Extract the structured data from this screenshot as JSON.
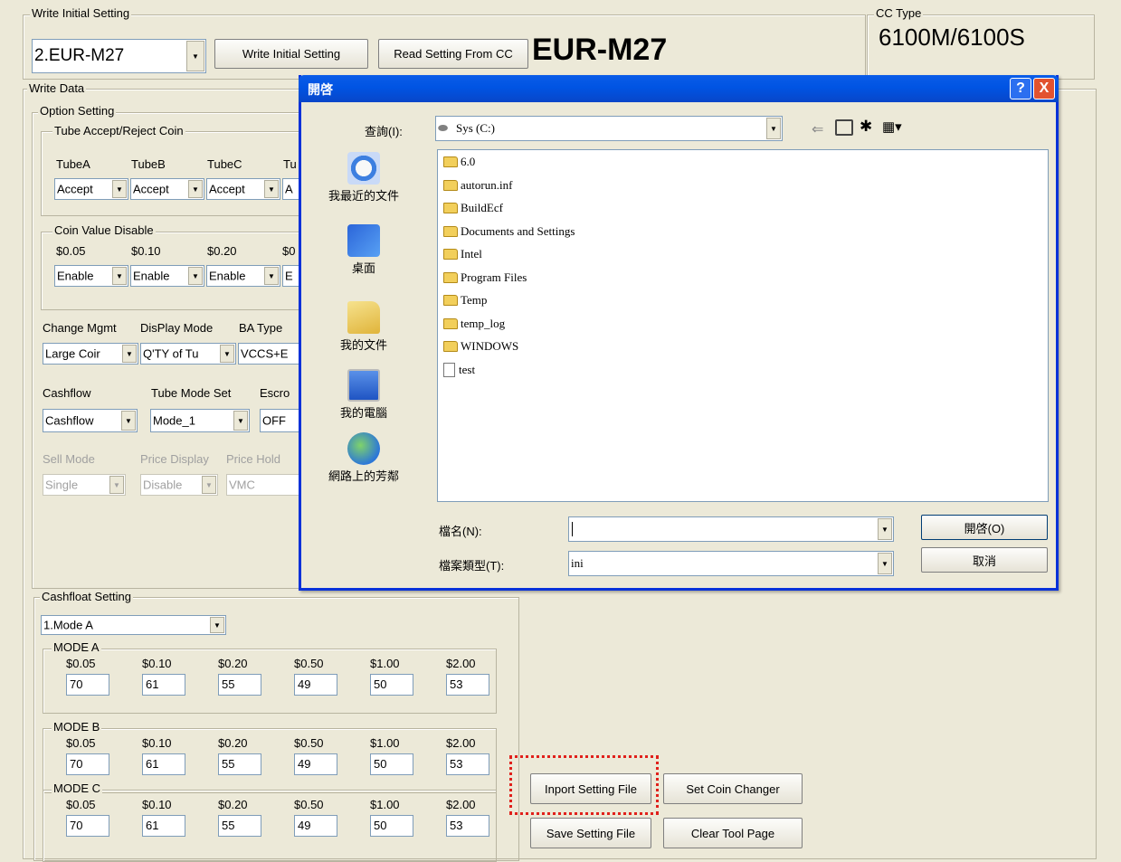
{
  "write_initial": {
    "legend": "Write Initial Setting",
    "combo_value": "2.EUR-M27",
    "write_button": "Write Initial Setting",
    "read_button": "Read Setting From CC",
    "big_label": "EUR-M27"
  },
  "cc_type": {
    "legend": "CC Type",
    "value": "6100M/6100S"
  },
  "write_data": {
    "legend": "Write Data",
    "option_legend": "Option Setting",
    "tube_legend": "Tube Accept/Reject Coin",
    "tube_headers": [
      "TubeA",
      "TubeB",
      "TubeC",
      "Tu"
    ],
    "tube_values": [
      "Accept",
      "Accept",
      "Accept",
      "A"
    ],
    "coin_legend": "Coin Value Disable",
    "coin_headers": [
      "$0.05",
      "$0.10",
      "$0.20",
      "$0"
    ],
    "coin_values": [
      "Enable",
      "Enable",
      "Enable",
      "E"
    ],
    "mgmt_headers": [
      "Change Mgmt",
      "DisPlay Mode",
      "BA Type"
    ],
    "mgmt_values": [
      "Large Coir",
      "Q'TY of Tu",
      "VCCS+E"
    ],
    "cash_headers": [
      "Cashflow",
      "Tube Mode Set",
      "Escro"
    ],
    "cash_values": [
      "Cashflow",
      "Mode_1",
      "OFF"
    ],
    "sell_headers": [
      "Sell Mode",
      "Price Display",
      "Price Hold"
    ],
    "sell_values": [
      "Single",
      "Disable",
      "VMC"
    ]
  },
  "cashfloat": {
    "legend": "Cashfloat Setting",
    "mode_select": "1.Mode A",
    "modes": [
      {
        "legend": "MODE A",
        "headers": [
          "$0.05",
          "$0.10",
          "$0.20",
          "$0.50",
          "$1.00",
          "$2.00"
        ],
        "values": [
          "70",
          "61",
          "55",
          "49",
          "50",
          "53"
        ]
      },
      {
        "legend": "MODE B",
        "headers": [
          "$0.05",
          "$0.10",
          "$0.20",
          "$0.50",
          "$1.00",
          "$2.00"
        ],
        "values": [
          "70",
          "61",
          "55",
          "49",
          "50",
          "53"
        ]
      },
      {
        "legend": "MODE C",
        "headers": [
          "$0.05",
          "$0.10",
          "$0.20",
          "$0.50",
          "$1.00",
          "$2.00"
        ],
        "values": [
          "70",
          "61",
          "55",
          "49",
          "50",
          "53"
        ]
      }
    ]
  },
  "actions": {
    "import": "Inport Setting File",
    "set_changer": "Set  Coin Changer",
    "save": "Save Setting File",
    "clear": "Clear Tool Page"
  },
  "dialog": {
    "title": "開啓",
    "help": "?",
    "close": "X",
    "lookin_label": "查詢(I):",
    "lookin_value": "Sys (C:)",
    "places": [
      "我最近的文件",
      "桌面",
      "我的文件",
      "我的電腦",
      "網路上的芳鄰"
    ],
    "files": [
      {
        "name": "6.0",
        "type": "folder"
      },
      {
        "name": "autorun.inf",
        "type": "folder"
      },
      {
        "name": "BuildEcf",
        "type": "folder"
      },
      {
        "name": "Documents and Settings",
        "type": "folder"
      },
      {
        "name": "Intel",
        "type": "folder"
      },
      {
        "name": "Program Files",
        "type": "folder"
      },
      {
        "name": "Temp",
        "type": "folder"
      },
      {
        "name": "temp_log",
        "type": "folder"
      },
      {
        "name": "WINDOWS",
        "type": "folder"
      },
      {
        "name": "test",
        "type": "file"
      }
    ],
    "filename_label": "檔名(N):",
    "filename_value": "",
    "filetype_label": "檔案類型(T):",
    "filetype_value": "ini",
    "open_button": "開啓(O)",
    "cancel_button": "取消"
  },
  "colors": {
    "accent": "#0054e3",
    "highlight": "#e0201b",
    "window_bg": "#ece9d8"
  }
}
